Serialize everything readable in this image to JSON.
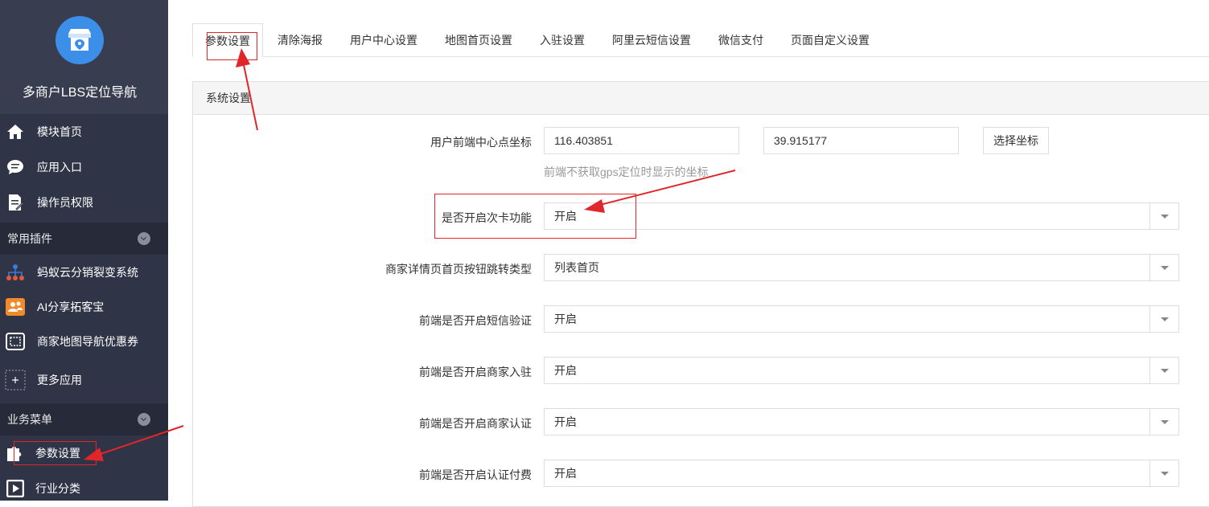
{
  "app": {
    "name": "多商户LBS定位导航"
  },
  "sidebar": {
    "items": [
      {
        "label": "模块首页",
        "icon": "home-icon"
      },
      {
        "label": "应用入口",
        "icon": "chat-bubble-icon"
      },
      {
        "label": "操作员权限",
        "icon": "document-edit-icon"
      }
    ],
    "group1": {
      "label": "常用插件"
    },
    "plugins": [
      {
        "label": "蚂蚁云分销裂变系统",
        "icon": "network-tree-icon"
      },
      {
        "label": "AI分享拓客宝",
        "icon": "users-icon"
      },
      {
        "label": "商家地图导航优惠券",
        "icon": "coupon-icon"
      },
      {
        "label": "更多应用",
        "icon": "plus-icon"
      }
    ],
    "group2": {
      "label": "业务菜单"
    },
    "business": [
      {
        "label": "参数设置",
        "icon": "puzzle-icon"
      },
      {
        "label": "行业分类",
        "icon": "play-box-icon"
      }
    ]
  },
  "tabs": [
    "参数设置",
    "清除海报",
    "用户中心设置",
    "地图首页设置",
    "入驻设置",
    "阿里云短信设置",
    "微信支付",
    "页面自定义设置"
  ],
  "panel": {
    "title": "系统设置",
    "coord": {
      "label": "用户前端中心点坐标",
      "lng": "116.403851",
      "lat": "39.915177",
      "button": "选择坐标",
      "help": "前端不获取gps定位时显示的坐标"
    },
    "fields": [
      {
        "label": "是否开启次卡功能",
        "value": "开启"
      },
      {
        "label": "商家详情页首页按钮跳转类型",
        "value": "列表首页"
      },
      {
        "label": "前端是否开启短信验证",
        "value": "开启"
      },
      {
        "label": "前端是否开启商家入驻",
        "value": "开启"
      },
      {
        "label": "前端是否开启商家认证",
        "value": "开启"
      },
      {
        "label": "前端是否开启认证付费",
        "value": "开启"
      }
    ]
  },
  "colors": {
    "sidebar": "#2f3446",
    "annotation": "#e0262a",
    "accent": "#3b8fe8"
  }
}
